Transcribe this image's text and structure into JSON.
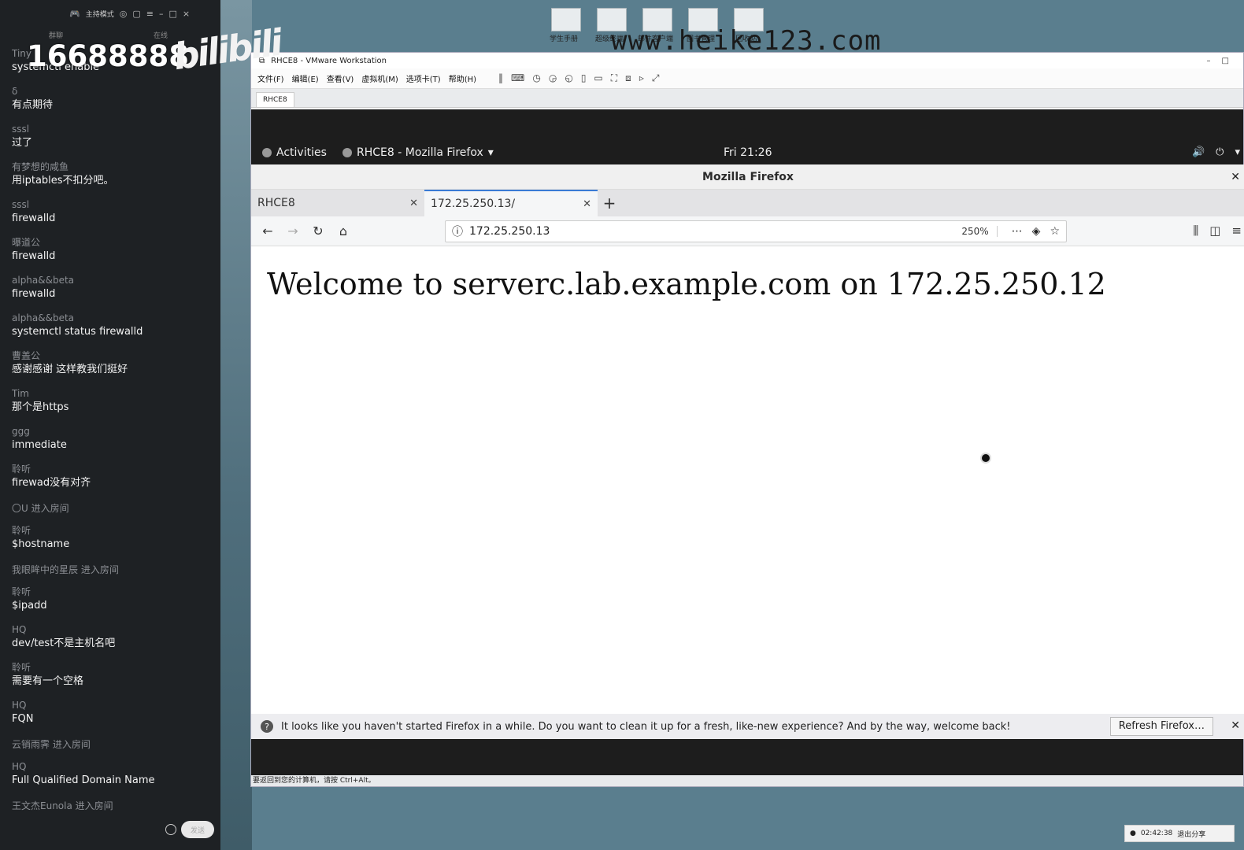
{
  "overlay": {
    "number": "16688888",
    "bili": "bilibili"
  },
  "chat": {
    "top_title": "主持模式",
    "tabs": [
      "群聊",
      "在线"
    ],
    "messages": [
      {
        "user": "Tiny",
        "text": "systemctl enable"
      },
      {
        "user": "δ",
        "text": "有点期待"
      },
      {
        "user": "sssl",
        "text": "过了"
      },
      {
        "user": "有梦想的咸鱼",
        "text": "用iptables不扣分吧。"
      },
      {
        "user": "sssl",
        "text": "firewalld"
      },
      {
        "user": "曝道公",
        "text": "firewalld"
      },
      {
        "user": "alpha&&beta",
        "text": "firewalld"
      },
      {
        "user": "alpha&&beta",
        "text": "systemctl status firewalld"
      },
      {
        "user": "曹盖公",
        "text": "感谢感谢  这样教我们挺好"
      },
      {
        "user": "Tim",
        "text": "那个是https"
      },
      {
        "user": "ggg",
        "text": "immediate"
      },
      {
        "user": "聆听",
        "text": "firewad没有对齐"
      },
      {
        "user": "〇U 进入房间",
        "text": "",
        "enter": true
      },
      {
        "user": "聆听",
        "text": "$hostname"
      },
      {
        "user": "我眼眸中的星辰 进入房间",
        "text": "",
        "enter": true
      },
      {
        "user": "聆听",
        "text": "$ipadd"
      },
      {
        "user": "HQ",
        "text": "dev/test不是主机名吧"
      },
      {
        "user": "聆听",
        "text": "需要有一个空格"
      },
      {
        "user": "HQ",
        "text": "FQN"
      },
      {
        "user": "云销雨霁 进入房间",
        "text": "",
        "enter": true
      },
      {
        "user": "HQ",
        "text": "Full Qualified Domain Name"
      },
      {
        "user": "王文杰Eunola 进入房间",
        "text": "",
        "enter": true
      }
    ],
    "send_label": "发送"
  },
  "desktop_icons": [
    "学生手册",
    "超级终端",
    "邮件客户端",
    "图书管理",
    "回收站"
  ],
  "vmware": {
    "title": "RHCE8 - VMware Workstation",
    "menu": [
      "文件(F)",
      "编辑(E)",
      "查看(V)",
      "虚拟机(M)",
      "选项卡(T)",
      "帮助(H)"
    ],
    "tab": "RHCE8",
    "watermark": "www.heike123.com",
    "status": "要返回到您的计算机，请按 Ctrl+Alt。"
  },
  "gnome": {
    "activities": "Activities",
    "app": "RHCE8 - Mozilla Firefox",
    "clock": "Fri 21:26"
  },
  "firefox": {
    "window_title": "Mozilla Firefox",
    "tabs": [
      {
        "label": "RHCE8",
        "active": false
      },
      {
        "label": "172.25.250.13/",
        "active": true
      }
    ],
    "url": "172.25.250.13",
    "zoom": "250%",
    "page_heading": "Welcome to serverc.lab.example.com on 172.25.250.12",
    "notification": "It looks like you haven't started Firefox in a while. Do you want to clean it up for a fresh, like-new experience? And by the way, welcome back!",
    "refresh_label": "Refresh Firefox…"
  },
  "tray": {
    "time": "02:42:38",
    "exit_share": "退出分享"
  }
}
